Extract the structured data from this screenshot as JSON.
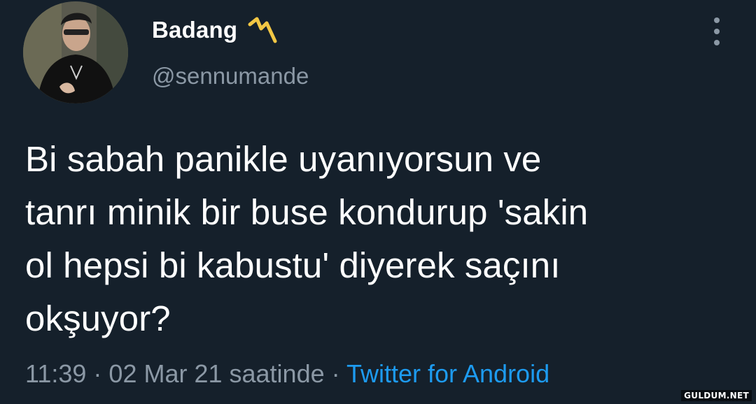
{
  "tweet": {
    "author": {
      "display_name": "Badang",
      "name_emoji": "lightning-scribble-emoji",
      "handle": "@sennumande"
    },
    "text": "Bi sabah panikle uyanıyorsun ve\ntanrı minik bir buse kondurup 'sakin\nol hepsi bi kabustu' diyerek saçını\nokşuyor?",
    "time": "11:39",
    "separator_1": " · ",
    "date": "02 Mar 21 saatinde",
    "separator_2": " · ",
    "source": "Twitter for Android"
  },
  "watermark": "GULDUM.NET",
  "colors": {
    "background": "#15202b",
    "text": "#ffffff",
    "muted": "#8b98a5",
    "link": "#1d9bf0",
    "emoji": "#f2c744"
  }
}
